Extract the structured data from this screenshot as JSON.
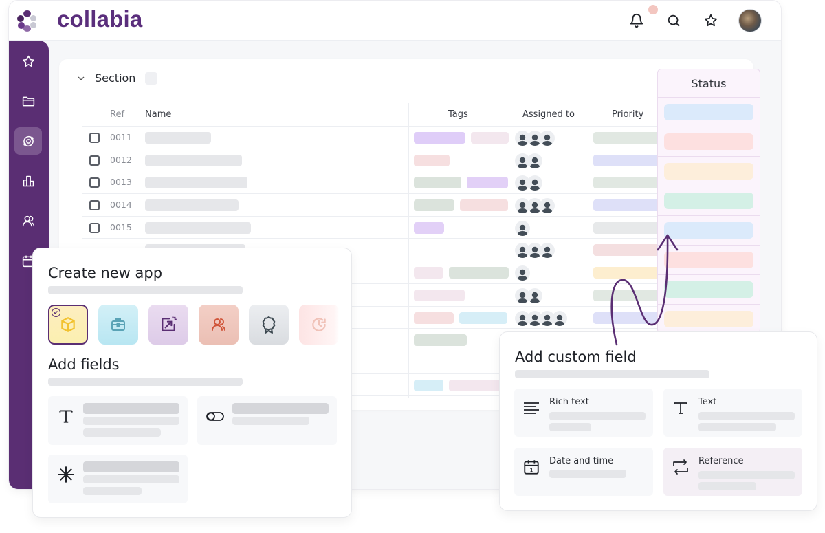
{
  "app": {
    "brand": "collabia"
  },
  "header": {
    "icons": [
      "bell-icon",
      "search-icon",
      "star-icon",
      "user-avatar"
    ],
    "notification_dot_color": "#f3c6c0"
  },
  "sidebar": {
    "items": [
      {
        "name": "favorites",
        "icon": "star-icon",
        "active": false
      },
      {
        "name": "files",
        "icon": "folder-icon",
        "active": false
      },
      {
        "name": "apps",
        "icon": "orbit-icon",
        "active": true
      },
      {
        "name": "reports",
        "icon": "bar-chart-icon",
        "active": false
      },
      {
        "name": "people",
        "icon": "users-icon",
        "active": false
      },
      {
        "name": "calendar",
        "icon": "calendar-icon",
        "active": false
      }
    ],
    "color": "#5a2e73"
  },
  "section": {
    "title": "Section"
  },
  "table": {
    "columns": {
      "ref": "Ref",
      "name": "Name",
      "tags": "Tags",
      "assigned": "Assigned to",
      "priority": "Priority",
      "status": "Status"
    },
    "rows": [
      {
        "ref": "0011",
        "assignees": 3
      },
      {
        "ref": "0012",
        "assignees": 2
      },
      {
        "ref": "0013",
        "assignees": 2
      },
      {
        "ref": "0014",
        "assignees": 3
      },
      {
        "ref": "0015",
        "assignees": 1
      },
      {
        "ref": "",
        "assignees": 3
      },
      {
        "ref": "",
        "assignees": 1
      },
      {
        "ref": "",
        "assignees": 2
      },
      {
        "ref": "",
        "assignees": 4
      },
      {
        "ref": "",
        "assignees": 0
      },
      {
        "ref": "",
        "assignees": 0
      },
      {
        "ref": "",
        "assignees": 0
      }
    ],
    "status_colors": [
      "#dbeafb",
      "#fde0e0",
      "#fdeedb",
      "#d4f0e6",
      "#dbeafb",
      "#fde0e0",
      "#d4f0e6",
      "#fdeedb"
    ]
  },
  "create_app": {
    "title": "Create new app",
    "fields_title": "Add fields",
    "app_templates": [
      {
        "icon": "cube-icon",
        "selected": true
      },
      {
        "icon": "briefcase-icon",
        "selected": false
      },
      {
        "icon": "share-export-icon",
        "selected": false
      },
      {
        "icon": "users-icon",
        "selected": false
      },
      {
        "icon": "award-badge-icon",
        "selected": false
      },
      {
        "icon": "clock-history-icon",
        "selected": false
      }
    ],
    "field_types": [
      {
        "icon": "text-type-icon"
      },
      {
        "icon": "toggle-icon"
      },
      {
        "icon": "asterisk-icon"
      }
    ]
  },
  "custom_field": {
    "title": "Add custom field",
    "options": [
      {
        "label": "Rich text",
        "icon": "align-left-icon"
      },
      {
        "label": "Text",
        "icon": "text-type-icon"
      },
      {
        "label": "Date and time",
        "icon": "calendar-icon"
      },
      {
        "label": "Reference",
        "icon": "swap-arrows-icon"
      }
    ]
  }
}
